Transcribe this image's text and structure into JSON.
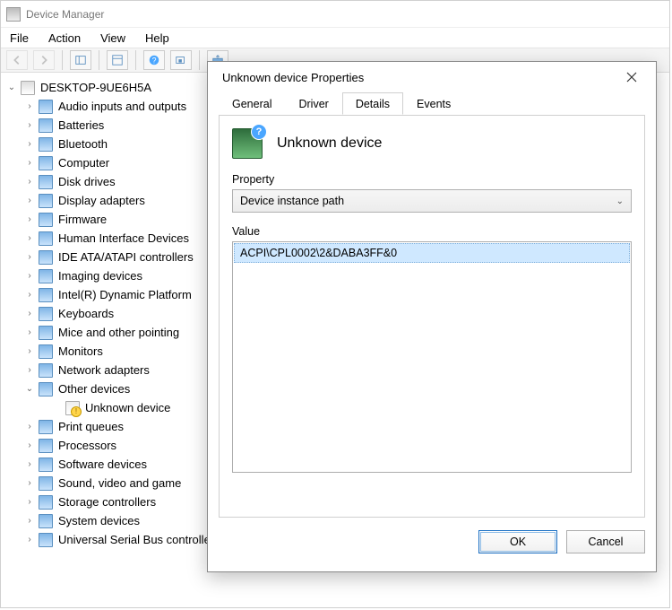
{
  "window": {
    "title": "Device Manager"
  },
  "menu": {
    "file": "File",
    "action": "Action",
    "view": "View",
    "help": "Help"
  },
  "root": {
    "name": "DESKTOP-9UE6H5A"
  },
  "categories": [
    {
      "label": "Audio inputs and outputs",
      "expanded": false
    },
    {
      "label": "Batteries",
      "expanded": false
    },
    {
      "label": "Bluetooth",
      "expanded": false
    },
    {
      "label": "Computer",
      "expanded": false
    },
    {
      "label": "Disk drives",
      "expanded": false
    },
    {
      "label": "Display adapters",
      "expanded": false
    },
    {
      "label": "Firmware",
      "expanded": false
    },
    {
      "label": "Human Interface Devices",
      "expanded": false
    },
    {
      "label": "IDE ATA/ATAPI controllers",
      "expanded": false
    },
    {
      "label": "Imaging devices",
      "expanded": false
    },
    {
      "label": "Intel(R) Dynamic Platform",
      "expanded": false
    },
    {
      "label": "Keyboards",
      "expanded": false
    },
    {
      "label": "Mice and other pointing",
      "expanded": false
    },
    {
      "label": "Monitors",
      "expanded": false
    },
    {
      "label": "Network adapters",
      "expanded": false
    },
    {
      "label": "Other devices",
      "expanded": true,
      "children": [
        {
          "label": "Unknown device",
          "warn": true
        }
      ]
    },
    {
      "label": "Print queues",
      "expanded": false
    },
    {
      "label": "Processors",
      "expanded": false
    },
    {
      "label": "Software devices",
      "expanded": false
    },
    {
      "label": "Sound, video and game",
      "expanded": false
    },
    {
      "label": "Storage controllers",
      "expanded": false
    },
    {
      "label": "System devices",
      "expanded": false
    },
    {
      "label": "Universal Serial Bus controllers",
      "expanded": false
    }
  ],
  "dialog": {
    "title": "Unknown device Properties",
    "tabs": {
      "general": "General",
      "driver": "Driver",
      "details": "Details",
      "events": "Events"
    },
    "active_tab": "details",
    "device_name": "Unknown device",
    "property_label": "Property",
    "property_value": "Device instance path",
    "value_label": "Value",
    "value_item": "ACPI\\CPL0002\\2&DABA3FF&0",
    "ok": "OK",
    "cancel": "Cancel"
  }
}
